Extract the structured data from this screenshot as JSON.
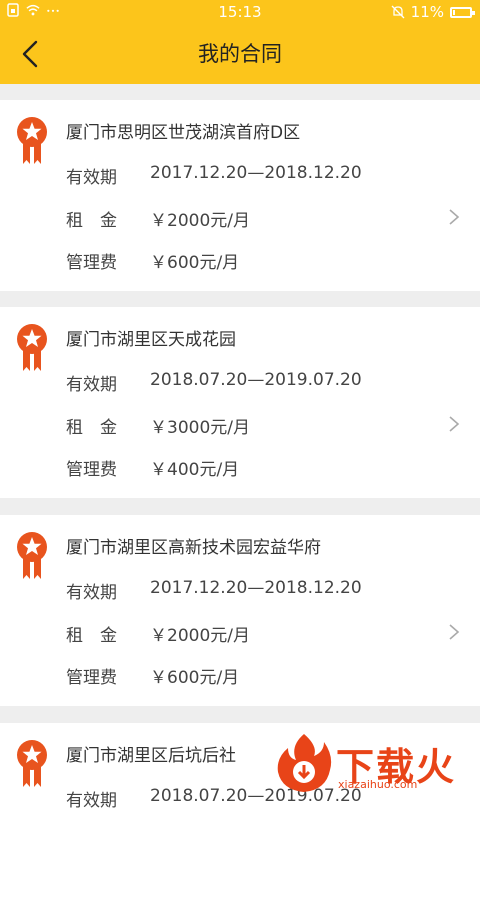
{
  "status_bar": {
    "time": "15:13",
    "battery": "11%",
    "battery_level": 0.11,
    "icons": [
      "sim-icon",
      "wifi-icon",
      "more-icon",
      "mute-icon",
      "battery-icon"
    ]
  },
  "header": {
    "title": "我的合同",
    "back_icon": "chevron-left-icon"
  },
  "labels": {
    "valid": "有效期",
    "rent": "租　金",
    "fee": "管理费"
  },
  "contracts": [
    {
      "address": "厦门市思明区世茂湖滨首府D区",
      "period": "2017.12.20—2018.12.20",
      "rent": "￥2000元/月",
      "fee": "￥600元/月"
    },
    {
      "address": "厦门市湖里区天成花园",
      "period": "2018.07.20—2019.07.20",
      "rent": "￥3000元/月",
      "fee": "￥400元/月"
    },
    {
      "address": "厦门市湖里区高新技术园宏益华府",
      "period": "2017.12.20—2018.12.20",
      "rent": "￥2000元/月",
      "fee": "￥600元/月"
    },
    {
      "address": "厦门市湖里区后坑后社",
      "period": "2018.07.20—2019.07.20",
      "rent": "",
      "fee": ""
    }
  ],
  "watermark": {
    "text": "下载火",
    "url": "xiazaihuo.com"
  },
  "colors": {
    "accent": "#fcc51b",
    "ribbon": "#e8541e",
    "watermark": "#e84418"
  }
}
